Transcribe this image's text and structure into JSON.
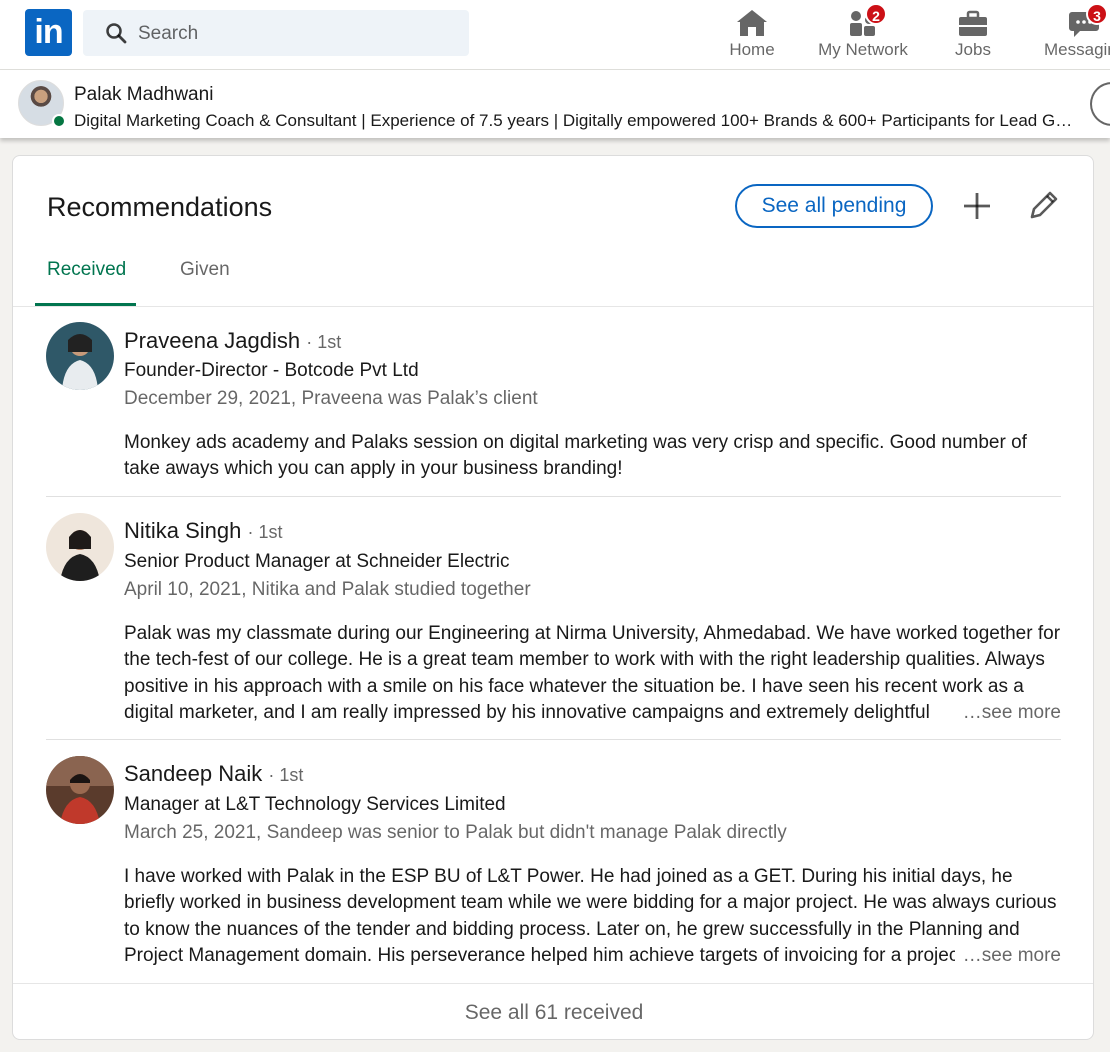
{
  "nav": {
    "logo_text": "in",
    "search_placeholder": "Search",
    "items": [
      {
        "label": "Home",
        "icon": "home-icon"
      },
      {
        "label": "My Network",
        "icon": "network-icon",
        "badge": "2"
      },
      {
        "label": "Jobs",
        "icon": "briefcase-icon"
      },
      {
        "label": "Messaging",
        "icon": "messaging-icon",
        "badge": "3"
      }
    ]
  },
  "profile_bar": {
    "name": "Palak Madhwani",
    "headline": "Digital Marketing Coach & Consultant | Experience of 7.5 years | Digitally empowered 100+ Brands & 600+ Participants for Lead Generation"
  },
  "recommendations": {
    "title": "Recommendations",
    "see_all_pending": "See all pending",
    "tabs": [
      "Received",
      "Given"
    ],
    "active_tab": "Received",
    "items": [
      {
        "name": "Praveena Jagdish",
        "degree": "· 1st",
        "title": "Founder-Director - Botcode Pvt Ltd",
        "meta": "December 29, 2021, Praveena was Palak’s client",
        "text": "Monkey ads academy and Palaks session on digital marketing was very crisp and specific. Good number of take aways which you can apply in your business branding!"
      },
      {
        "name": "Nitika Singh",
        "degree": "· 1st",
        "title": "Senior Product Manager at Schneider Electric",
        "meta": "April 10, 2021, Nitika and Palak studied together",
        "text": "Palak was my classmate during our Engineering at Nirma University, Ahmedabad. We have worked together for the tech-fest of our college. He is a great team member to work with with the right leadership qualities. Always positive in his approach with a smile on his face whatever the situation be. I have seen his recent work as a digital marketer, and I am really impressed by his innovative campaigns and extremely delightful",
        "see_more": "…see more"
      },
      {
        "name": "Sandeep Naik",
        "degree": "· 1st",
        "title": "Manager at L&T Technology Services Limited",
        "meta": "March 25, 2021, Sandeep was senior to Palak but didn't manage Palak directly",
        "text": "I have worked with Palak in the ESP BU of L&T Power. He had joined as a GET. During his initial days, he briefly worked in business development team while we were bidding for a major project. He was always curious to know the nuances of the tender and bidding process. Later on, he grew successfully in the Planning and Project Management domain. His perseverance helped him achieve targets of invoicing for a project",
        "see_more": "…see more"
      }
    ],
    "footer": "See all 61 received"
  },
  "colors": {
    "brand": "#0a66c2",
    "tab_active": "#01754f",
    "badge": "#cc1016",
    "online": "#057642"
  }
}
